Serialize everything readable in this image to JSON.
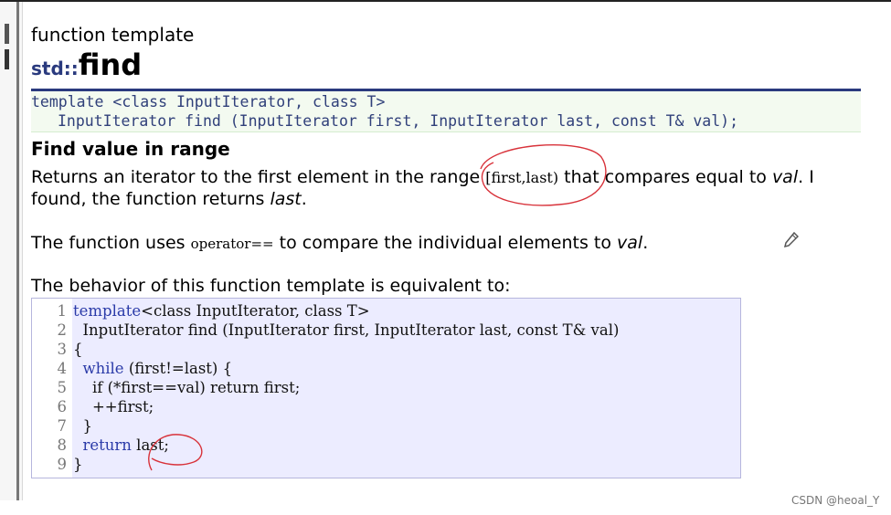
{
  "doc": {
    "kind": "function template",
    "namespace": "std::",
    "name": "find",
    "prototype": {
      "line1": "template <class InputIterator, class T>",
      "line2": "InputIterator find (InputIterator first, InputIterator last, const T& val);"
    },
    "heading": "Find value in range",
    "para1": {
      "a": "Returns an iterator to the first element in the range ",
      "range": "[first,last)",
      "b": " that compares equal to ",
      "val": "val",
      "c": ". I",
      "d": "found, the function returns ",
      "last": "last",
      "e": "."
    },
    "para2": {
      "a": "The function uses ",
      "op": "operator==",
      "b": " to compare the individual elements to ",
      "val": "val",
      "c": "."
    },
    "para3": "The behavior of this function template is equivalent to:"
  },
  "code": [
    {
      "n": "1",
      "indent": "",
      "kw": "template",
      "t": "<class InputIterator, class T>"
    },
    {
      "n": "2",
      "indent": "  ",
      "kw": "",
      "t": "InputIterator find (InputIterator first, InputIterator last, const T& val)"
    },
    {
      "n": "3",
      "indent": "",
      "kw": "",
      "t": "{"
    },
    {
      "n": "4",
      "indent": "  ",
      "kw": "while",
      "t": " (first!=last) {"
    },
    {
      "n": "5",
      "indent": "    ",
      "kw": "",
      "t": "if (*first==val) return first;"
    },
    {
      "n": "6",
      "indent": "    ",
      "kw": "",
      "t": "++first;"
    },
    {
      "n": "7",
      "indent": "  ",
      "kw": "",
      "t": "}"
    },
    {
      "n": "8",
      "indent": "  ",
      "kw": "return",
      "t": " last;"
    },
    {
      "n": "9",
      "indent": "",
      "kw": "",
      "t": "}"
    }
  ],
  "icons": {
    "edit": "pencil-icon"
  },
  "colors": {
    "accent": "#2a3a7e",
    "annotation": "#d8323a",
    "code_bg": "#ececff",
    "proto_bg": "#f3faf0"
  },
  "watermark": "CSDN @heoal_Y"
}
